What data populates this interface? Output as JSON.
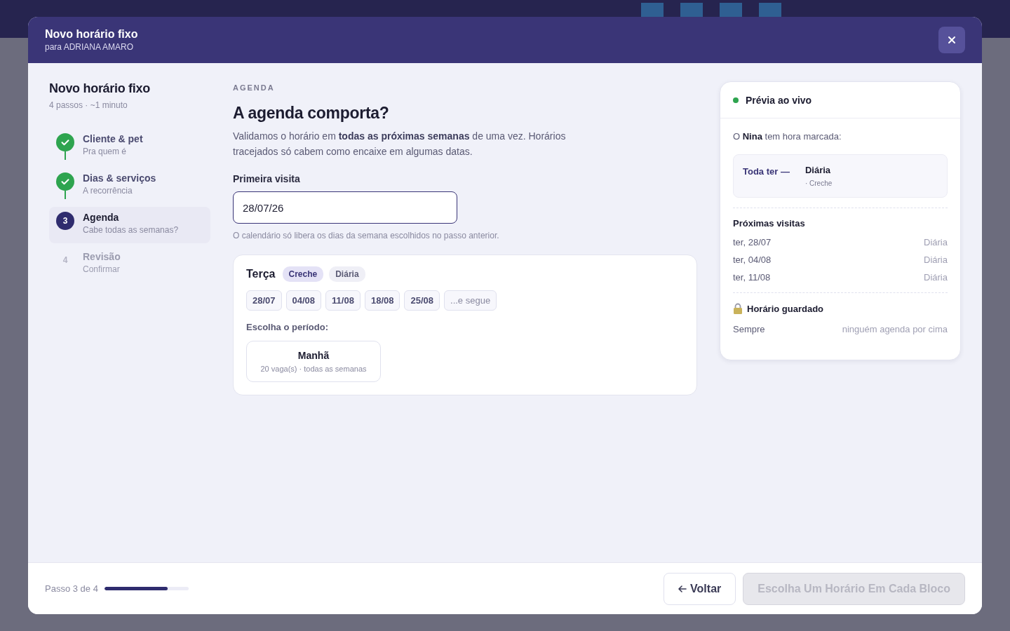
{
  "modal": {
    "title": "Novo horário fixo",
    "subtitle": "para ADRIANA AMARO"
  },
  "stepper": {
    "title": "Novo horário fixo",
    "meta": "4 passos · ~1 minuto",
    "steps": [
      {
        "label": "Cliente & pet",
        "hint": "Pra quem é",
        "completed": true,
        "selected": false
      },
      {
        "label": "Dias & serviços",
        "hint": "A recorrência",
        "completed": true,
        "selected": false
      },
      {
        "number": "3",
        "label": "Agenda",
        "hint": "Cabe todas as semanas?",
        "completed": false,
        "selected": true
      },
      {
        "number": "4",
        "label": "Revisão",
        "hint": "Confirmar",
        "completed": false,
        "selected": false
      }
    ]
  },
  "main": {
    "eyebrow": "AGENDA",
    "heading": "A agenda comporta?",
    "intro": "Validamos o horário em **todas as próximas semanas** de uma vez. Horários tracejados só cabem como encaixe em algumas datas.",
    "first_visit": {
      "label": "Primeira visita",
      "value": "28/07/26",
      "help": "O calendário só libera os dias da semana escolhidos no passo anterior."
    },
    "day_block": {
      "day": "Terça",
      "tags": [
        {
          "label": "Creche",
          "color": "#e4e2f6"
        },
        {
          "label": "Diária",
          "color": "#efeff6"
        }
      ],
      "dates": [
        {
          "label": "28/07",
          "kind": "date"
        },
        {
          "label": "04/08",
          "kind": "date"
        },
        {
          "label": "11/08",
          "kind": "date"
        },
        {
          "label": "18/08",
          "kind": "date"
        },
        {
          "label": "25/08",
          "kind": "date"
        },
        {
          "label": "...e segue",
          "kind": "more"
        }
      ],
      "period_label": "Escolha o período:",
      "periods": [
        {
          "name": "Manhã",
          "detail": "20 vaga(s) · todas as semanas",
          "selected": false
        }
      ]
    }
  },
  "preview": {
    "title": "Prévia ao vivo",
    "live": true,
    "intro": "O **Nina** tem hora marcada:",
    "summary": {
      "when": "Toda ter —",
      "plan": "Diária",
      "service": "· Creche"
    },
    "upcoming_title": "Próximas visitas",
    "upcoming": [
      {
        "date": "ter, 28/07",
        "plan": "Diária"
      },
      {
        "date": "ter, 04/08",
        "plan": "Diária"
      },
      {
        "date": "ter, 11/08",
        "plan": "Diária"
      }
    ],
    "guard_title": "Horário guardado",
    "guard_left": "Sempre",
    "guard_right": "ninguém agenda por cima"
  },
  "footer": {
    "step_text": "Passo 3 de 4",
    "level": 0.75,
    "back": "Voltar",
    "next": {
      "label": "Escolha Um Horário Em Cada Bloco",
      "disabled": true
    }
  }
}
